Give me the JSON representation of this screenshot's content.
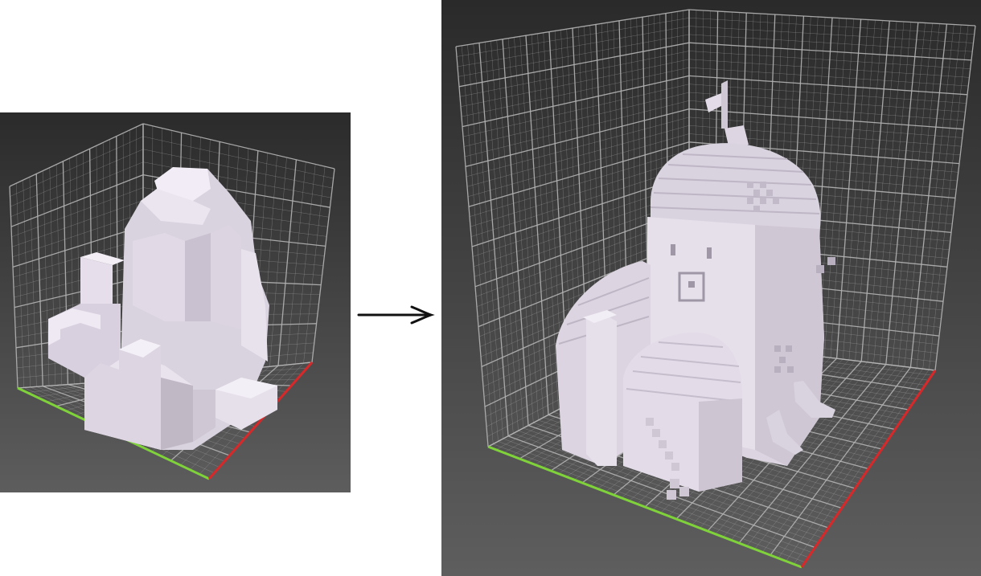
{
  "figure": {
    "left_panel": {
      "model": "coarse-voxel-building-mass",
      "view": "3d-viewport-with-grid"
    },
    "right_panel": {
      "model": "detailed-voxel-domed-house",
      "view": "3d-viewport-with-grid"
    },
    "connector": {
      "icon": "right-arrow-icon"
    }
  },
  "colors": {
    "viewport_top": "#2c2c2c",
    "viewport_bottom": "#5c5c5c",
    "grid_line": "#b9b9b9",
    "voxel_light": "#f0ebf4",
    "voxel_mid": "#d9d2df",
    "voxel_dark": "#b8afbd",
    "x_axis": "#d8282a",
    "y_axis": "#7fd23a",
    "arrow": "#111111"
  }
}
